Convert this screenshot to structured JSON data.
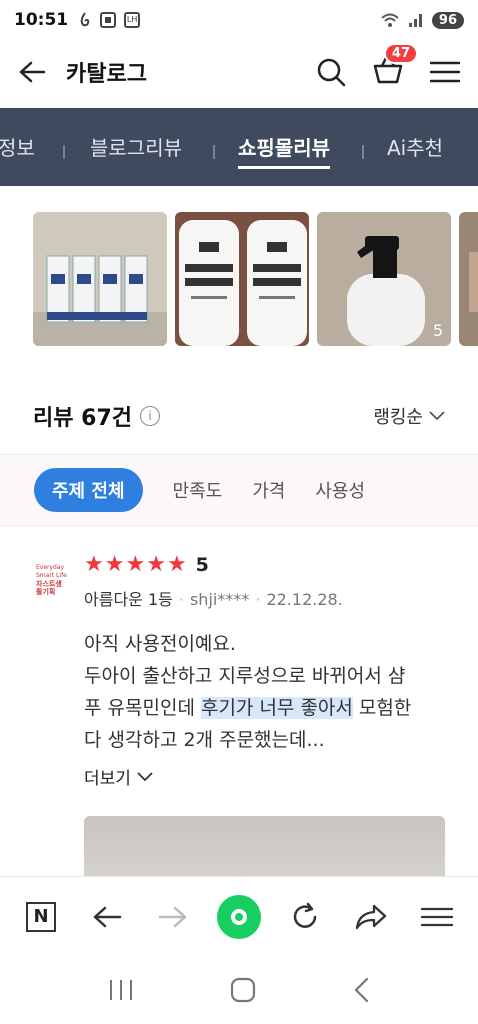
{
  "status": {
    "time": "10:51",
    "badge_lh": "LH",
    "battery": "96"
  },
  "header": {
    "title": "카탈로그",
    "cart_count": "47"
  },
  "tabs": [
    {
      "label": "정보"
    },
    {
      "label": "블로그리뷰"
    },
    {
      "label": "쇼핑몰리뷰"
    },
    {
      "label": "Ai추천"
    }
  ],
  "thumbnails": {
    "more_count": "5"
  },
  "reviews_header": {
    "title": "리뷰 67건",
    "sort_label": "랭킹순"
  },
  "filters": [
    {
      "label": "주제 전체"
    },
    {
      "label": "만족도"
    },
    {
      "label": "가격"
    },
    {
      "label": "사용성"
    }
  ],
  "review": {
    "shop_logo": {
      "line1": "Everyday Smart Life",
      "line2": "자스트생활기획"
    },
    "rating": 5,
    "score_text": "5",
    "author_rank": "아름다운 1등",
    "user": "shji****",
    "date": "22.12.28.",
    "line1": "아직 사용전이예요.",
    "line2": "두아이 출산하고 지루성으로 바뀌어서 샴",
    "line3_a": "푸 유목민인데 ",
    "line3_hl": "후기가 너무 좋아서",
    "line3_b": " 모험한",
    "line4": "다 생각하고 2개 주문했는데...",
    "more_label": "더보기"
  },
  "colors": {
    "tab_bg": "#3f4a5e",
    "accent": "#2f7fe0",
    "star": "#f0383b",
    "naver_green": "#19ce60",
    "cart_badge": "#f04040"
  }
}
